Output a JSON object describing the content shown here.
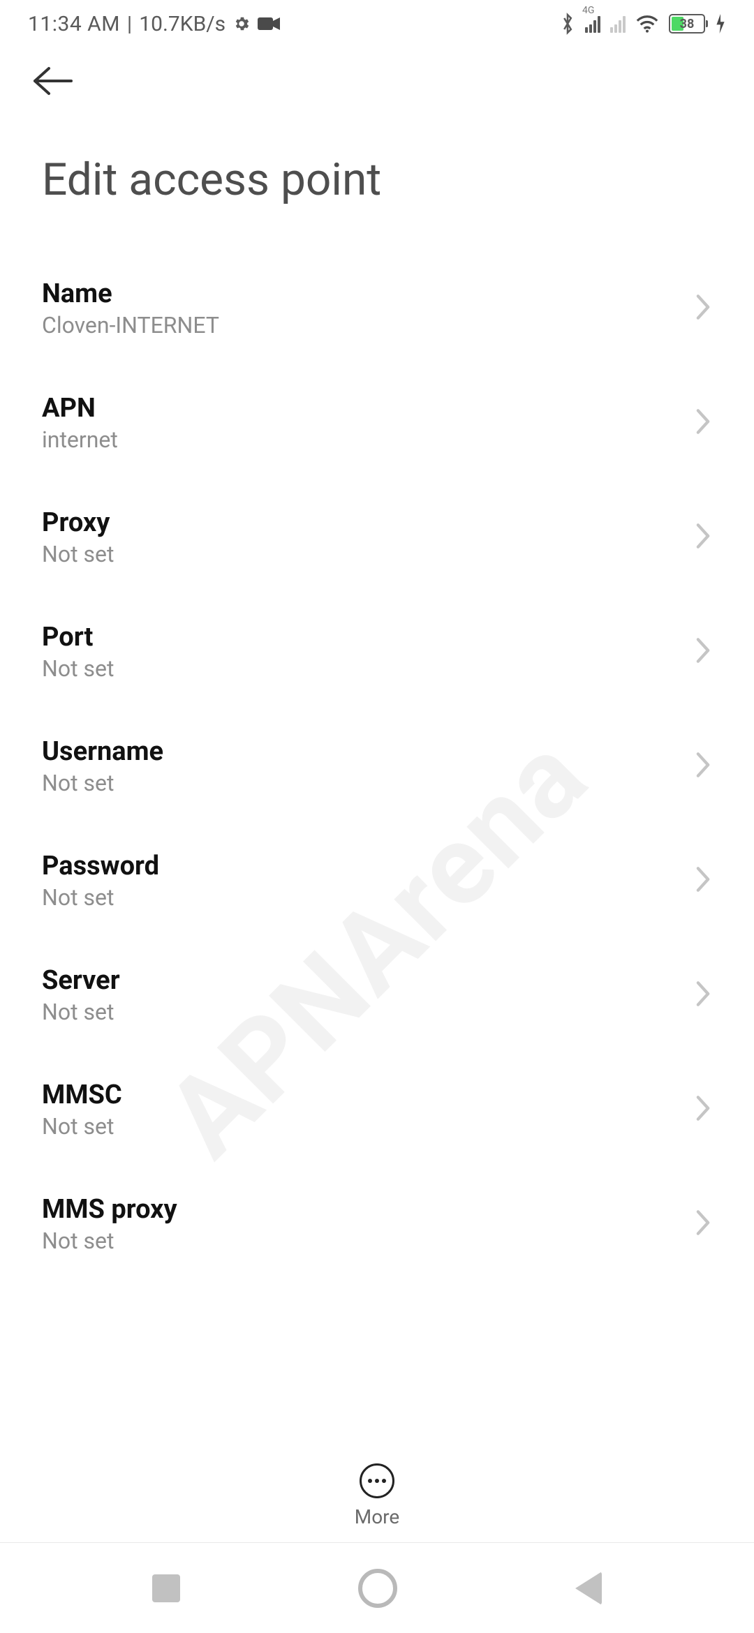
{
  "status_bar": {
    "time": "11:34 AM",
    "separator": "|",
    "net_speed": "10.7KB/s",
    "network_type": "4G",
    "battery_pct": "38"
  },
  "header": {
    "title": "Edit access point"
  },
  "settings": [
    {
      "label": "Name",
      "value": "Cloven-INTERNET"
    },
    {
      "label": "APN",
      "value": "internet"
    },
    {
      "label": "Proxy",
      "value": "Not set"
    },
    {
      "label": "Port",
      "value": "Not set"
    },
    {
      "label": "Username",
      "value": "Not set"
    },
    {
      "label": "Password",
      "value": "Not set"
    },
    {
      "label": "Server",
      "value": "Not set"
    },
    {
      "label": "MMSC",
      "value": "Not set"
    },
    {
      "label": "MMS proxy",
      "value": "Not set"
    }
  ],
  "footer": {
    "more_label": "More"
  },
  "watermark": "APNArena"
}
